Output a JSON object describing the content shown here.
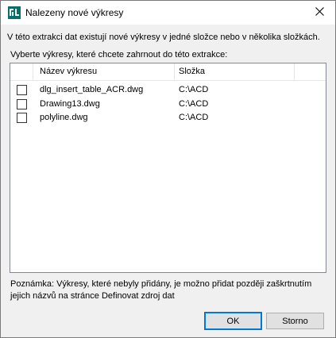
{
  "window": {
    "title": "Nalezeny nové výkresy",
    "close_icon": "close-icon",
    "app_icon": "autocad-data-extraction-icon"
  },
  "description": "V této extrakci dat existují nové výkresy v jedné složce nebo v několika složkách.",
  "select_label": "Vyberte výkresy, které chcete zahrnout do této extrakce:",
  "list": {
    "headers": {
      "name": "Název výkresu",
      "folder": "Složka"
    },
    "rows": [
      {
        "checked": false,
        "name": "dlg_insert_table_ACR.dwg",
        "folder": "C:\\ACD"
      },
      {
        "checked": false,
        "name": "Drawing13.dwg",
        "folder": "C:\\ACD"
      },
      {
        "checked": false,
        "name": "polyline.dwg",
        "folder": "C:\\ACD"
      }
    ]
  },
  "note": "Poznámka: Výkresy, které nebyly přidány, je možno přidat později zaškrtnutím jejich názvů na stránce Definovat zdroj dat",
  "buttons": {
    "ok": "OK",
    "cancel": "Storno"
  },
  "colors": {
    "focus_border": "#0078d7",
    "icon_teal": "#0b6e6e"
  }
}
